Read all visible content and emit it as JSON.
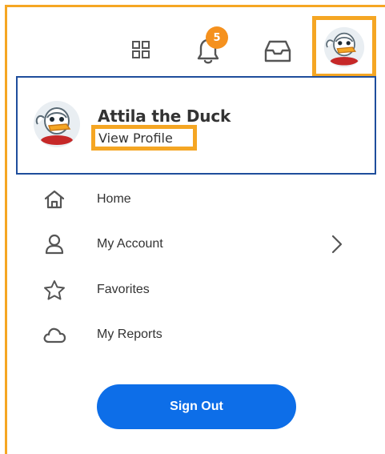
{
  "topbar": {
    "apps_icon": "apps-grid-icon",
    "notifications_icon": "bell-icon",
    "notifications_count": "5",
    "inbox_icon": "inbox-icon",
    "avatar_icon": "duck-avatar-icon"
  },
  "profile": {
    "name": "Attila the Duck",
    "view_profile_label": "View Profile"
  },
  "menu": {
    "items": [
      {
        "label": "Home",
        "icon": "home-icon"
      },
      {
        "label": "My Account",
        "icon": "user-icon",
        "has_submenu": true
      },
      {
        "label": "Favorites",
        "icon": "star-icon"
      },
      {
        "label": "My Reports",
        "icon": "cloud-icon"
      }
    ]
  },
  "sign_out_label": "Sign Out",
  "colors": {
    "highlight": "#f5a623",
    "badge": "#f5911e",
    "card_border": "#1f4e9c",
    "primary_button": "#0d6ee8",
    "icon_gray": "#555555"
  }
}
